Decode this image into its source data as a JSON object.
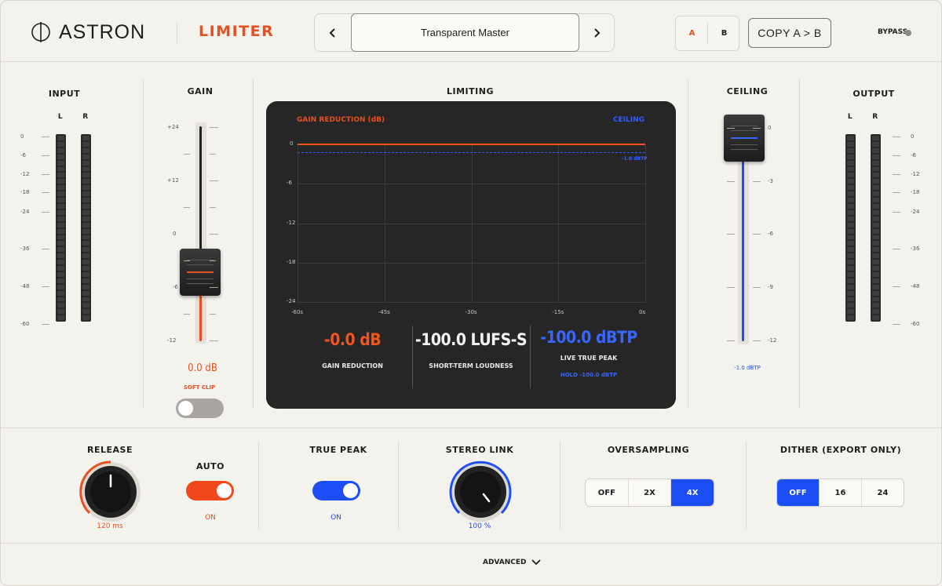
{
  "header": {
    "brand": "ASTRON",
    "plugin": "LIMITER",
    "preset": "Transparent Master",
    "prev_icon": "chevron-left-icon",
    "next_icon": "chevron-right-icon",
    "ab": {
      "a": "A",
      "b": "B"
    },
    "copy": "COPY A > B",
    "bypass": "BYPASS"
  },
  "input": {
    "title": "INPUT",
    "left": "L",
    "right": "R",
    "scale": [
      "0",
      "-6",
      "-12",
      "-18",
      "-24",
      "-36",
      "-48",
      "-60"
    ]
  },
  "gain": {
    "title": "GAIN",
    "scale": [
      "+24",
      "+12",
      "0",
      "-6",
      "-12"
    ],
    "value": "0.0 dB",
    "soft_clip": "SOFT CLIP",
    "soft_clip_on": false
  },
  "limiting": {
    "title": "LIMITING",
    "gr_label": "GAIN REDUCTION (dB)",
    "ceiling_label": "CEILING",
    "ceiling_line": "-1.0 dBTP",
    "y_labels": [
      "0",
      "-6",
      "-12",
      "-18",
      "-24"
    ],
    "x_labels": [
      "-60s",
      "-45s",
      "-30s",
      "-15s",
      "0s"
    ],
    "readouts": {
      "gr_value": "-0.0 dB",
      "gr_label": "GAIN REDUCTION",
      "lufs_value": "-100.0 LUFS-S",
      "lufs_label": "SHORT-TERM LOUDNESS",
      "tp_value": "-100.0 dBTP",
      "tp_label": "LIVE TRUE PEAK",
      "hold": "HOLD -100.0 dBTP"
    }
  },
  "ceiling": {
    "title": "CEILING",
    "scale": [
      "0",
      "-3",
      "-6",
      "-9",
      "-12"
    ],
    "value": "-1.0 dBTP"
  },
  "output": {
    "title": "OUTPUT",
    "left": "L",
    "right": "R",
    "scale": [
      "0",
      "-6",
      "-12",
      "-18",
      "-24",
      "-36",
      "-48",
      "-60"
    ]
  },
  "controls": {
    "release": {
      "title": "RELEASE",
      "value": "120 ms"
    },
    "auto": {
      "title": "AUTO",
      "state": "ON"
    },
    "true_peak": {
      "title": "TRUE PEAK",
      "state": "ON"
    },
    "stereo_link": {
      "title": "STEREO LINK",
      "value": "100 %"
    },
    "oversampling": {
      "title": "OVERSAMPLING",
      "options": [
        "OFF",
        "2X",
        "4X"
      ],
      "selected": "4X"
    },
    "dither": {
      "title": "DITHER (EXPORT ONLY)",
      "options": [
        "OFF",
        "16",
        "24"
      ],
      "selected": "OFF"
    }
  },
  "footer": {
    "advanced": "ADVANCED",
    "icon": "chevron-down-icon"
  },
  "colors": {
    "accent_orange": "#e8501f",
    "accent_blue": "#1d4ef5",
    "panel": "#262626"
  }
}
